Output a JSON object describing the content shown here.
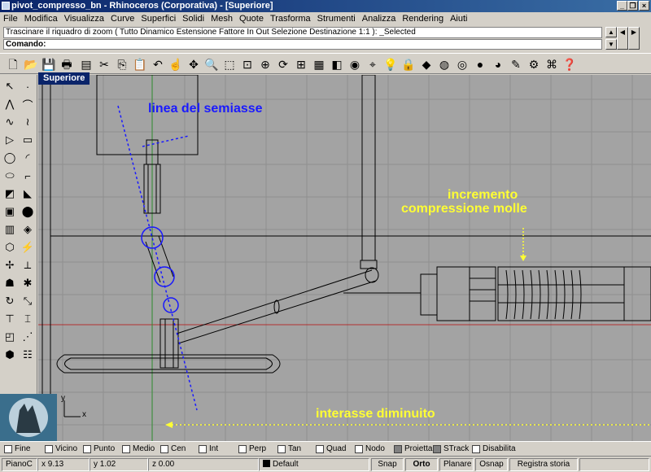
{
  "window": {
    "title": "pivot_compresso_bn - Rhinoceros (Corporativa) - [Superiore]",
    "min_label": "_",
    "restore_label": "❐",
    "close_label": "×"
  },
  "menu": [
    "File",
    "Modifica",
    "Visualizza",
    "Curve",
    "Superfici",
    "Solidi",
    "Mesh",
    "Quote",
    "Trasforma",
    "Strumenti",
    "Analizza",
    "Rendering",
    "Aiuti"
  ],
  "command": {
    "history": "Trascinare il riquadro di zoom ( Tutto  Dinamico  Estensione  Fattore  In  Out  Selezione  Destinazione  1:1 ): _Selected",
    "prompt": "Comando:"
  },
  "viewport": {
    "name": "Superiore",
    "axis_x": "x",
    "axis_y": "y"
  },
  "annotations": {
    "semiaxis": "linea del semiasse",
    "compression_1": "incremento",
    "compression_2": "compressione molle",
    "wheelbase": "interasse diminuito",
    "color_blue": "#1a1aff",
    "color_yellow": "#ffff33"
  },
  "osnap": [
    {
      "label": "Fine",
      "checked": false
    },
    {
      "label": "Vicino",
      "checked": false
    },
    {
      "label": "Punto",
      "checked": false
    },
    {
      "label": "Medio",
      "checked": false
    },
    {
      "label": "Cen",
      "checked": false
    },
    {
      "label": "Int",
      "checked": false
    },
    {
      "label": "Perp",
      "checked": false
    },
    {
      "label": "Tan",
      "checked": false
    },
    {
      "label": "Quad",
      "checked": false
    },
    {
      "label": "Nodo",
      "checked": false
    },
    {
      "label": "Proietta",
      "checked": true
    },
    {
      "label": "STrack",
      "checked": true
    },
    {
      "label": "Disabilita",
      "checked": false
    }
  ],
  "status": {
    "cplane": "PianoC",
    "x": "x 9.13",
    "y": "y 1.02",
    "z": "z 0.00",
    "layer": "Default",
    "snap": "Snap",
    "ortho": "Orto",
    "planar": "Planare",
    "osnap": "Osnap",
    "history": "Registra storia"
  }
}
